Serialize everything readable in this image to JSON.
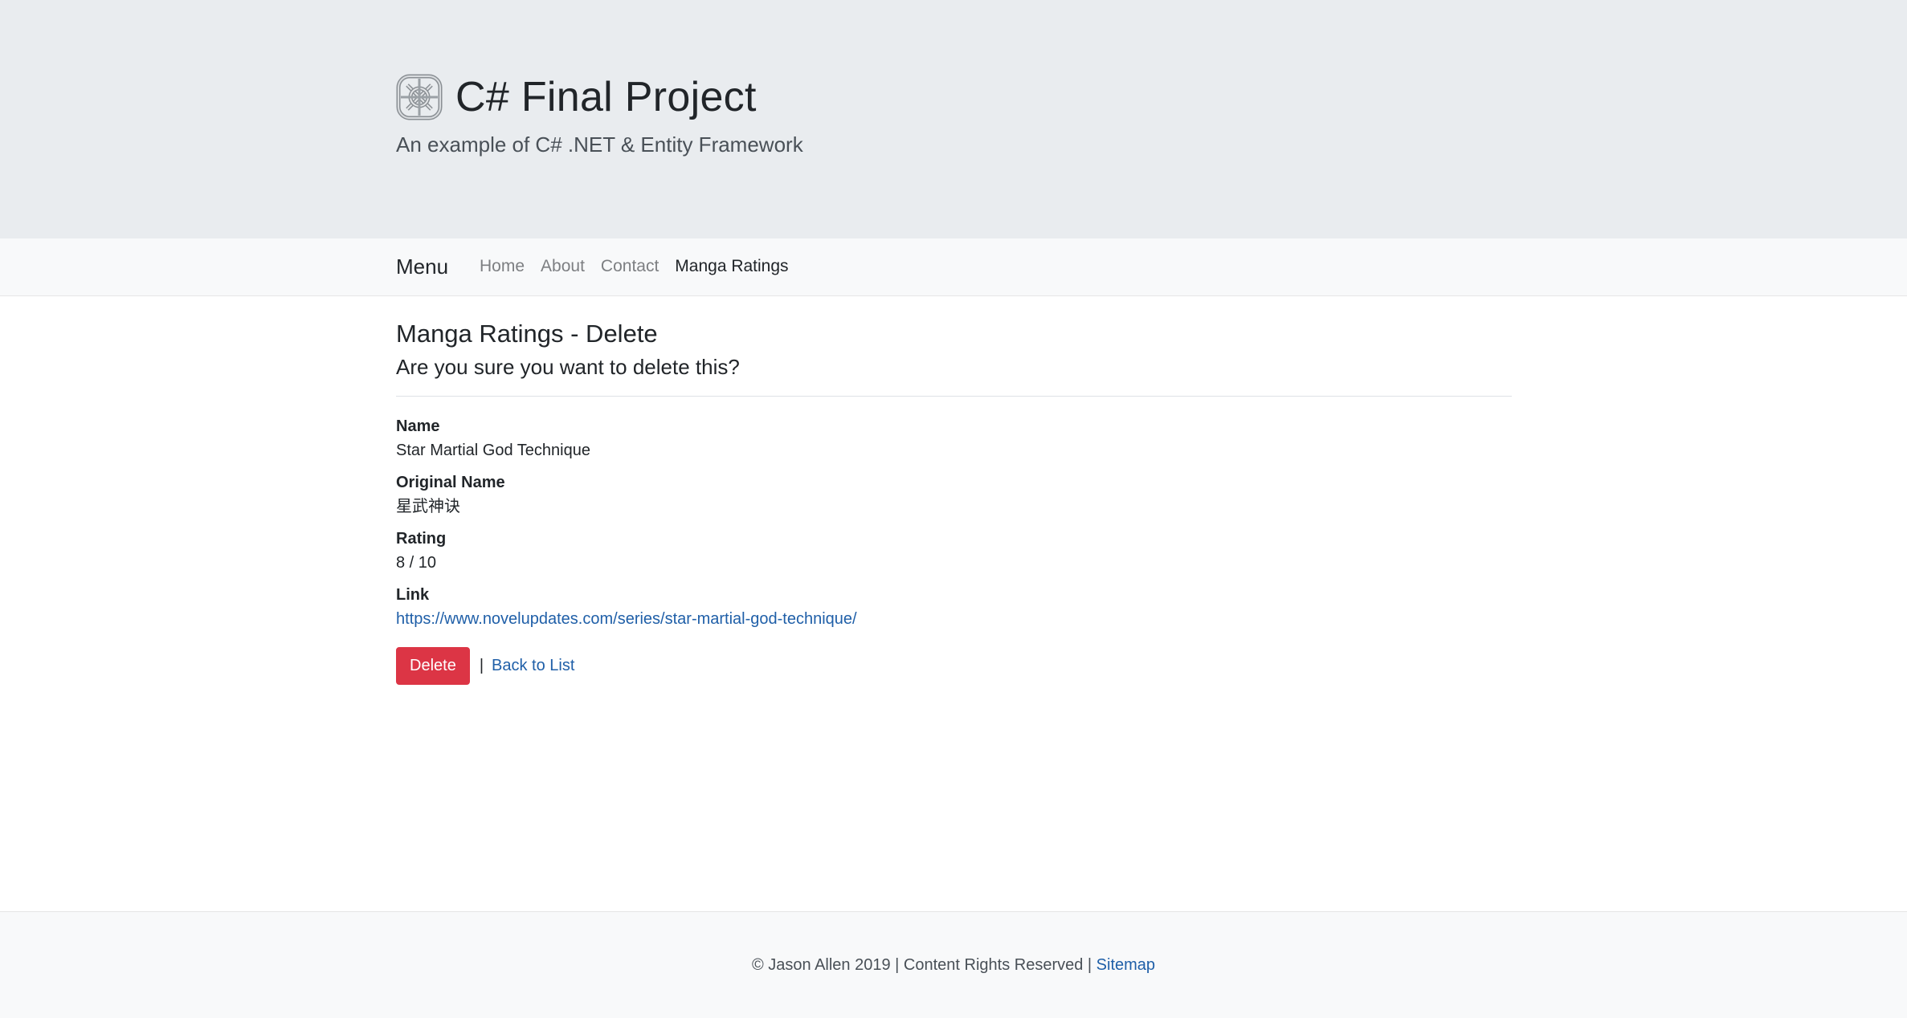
{
  "header": {
    "logo_icon": "celtic-knot-logo",
    "title": "C# Final Project",
    "subtitle": "An example of C# .NET & Entity Framework"
  },
  "navbar": {
    "brand": "Menu",
    "links": [
      {
        "label": "Home",
        "active": false
      },
      {
        "label": "About",
        "active": false
      },
      {
        "label": "Contact",
        "active": false
      },
      {
        "label": "Manga Ratings",
        "active": true
      }
    ]
  },
  "main": {
    "title": "Manga Ratings - Delete",
    "question": "Are you sure you want to delete this?",
    "fields": [
      {
        "label": "Name",
        "value": "Star Martial God Technique"
      },
      {
        "label": "Original Name",
        "value": "星武神诀"
      },
      {
        "label": "Rating",
        "value": "8 / 10"
      },
      {
        "label": "Link",
        "value": "https://www.novelupdates.com/series/star-martial-god-technique/"
      }
    ],
    "delete_button": "Delete",
    "separator": "|",
    "back_link": "Back to List"
  },
  "footer": {
    "text": "© Jason Allen 2019 | Content Rights Reserved | ",
    "sitemap": "Sitemap"
  },
  "colors": {
    "jumbotron_bg": "#e9ecef",
    "navbar_bg": "#f8f9fa",
    "danger": "#dc3545",
    "link": "#1f5fa8"
  }
}
